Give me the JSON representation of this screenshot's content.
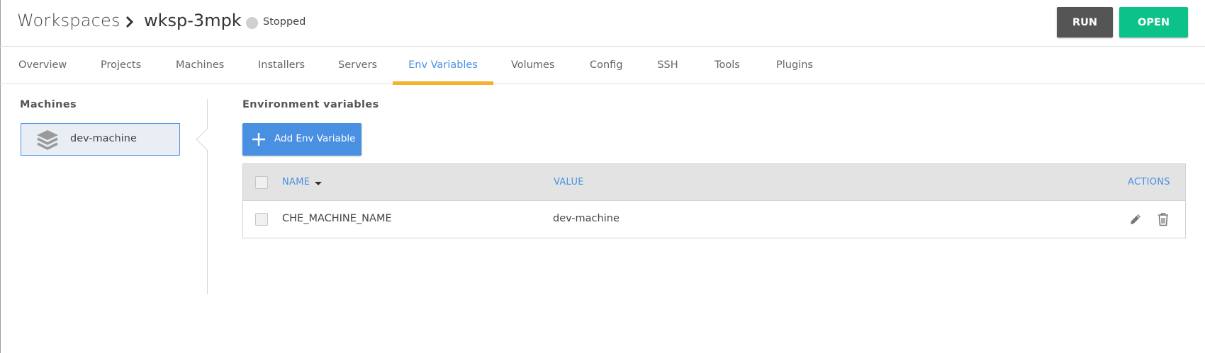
{
  "header": {
    "breadcrumb_root": "Workspaces",
    "workspace_name": "wksp-3mpk",
    "status": "Stopped",
    "run_label": "RUN",
    "open_label": "OPEN"
  },
  "tabs": [
    {
      "label": "Overview"
    },
    {
      "label": "Projects"
    },
    {
      "label": "Machines"
    },
    {
      "label": "Installers"
    },
    {
      "label": "Servers"
    },
    {
      "label": "Env Variables",
      "active": true
    },
    {
      "label": "Volumes"
    },
    {
      "label": "Config"
    },
    {
      "label": "SSH"
    },
    {
      "label": "Tools"
    },
    {
      "label": "Plugins"
    }
  ],
  "machines": {
    "title": "Machines",
    "items": [
      {
        "label": "dev-machine",
        "icon": "stack-layers-icon",
        "selected": true
      }
    ]
  },
  "env": {
    "title": "Environment variables",
    "add_label": "Add Env Variable",
    "columns": {
      "name": "NAME",
      "value": "VALUE",
      "actions": "ACTIONS"
    },
    "rows": [
      {
        "name": "CHE_MACHINE_NAME",
        "value": "dev-machine",
        "actions": [
          "pencil-icon",
          "trash-icon"
        ]
      }
    ]
  },
  "colors": {
    "accent": "#4a90e2",
    "tab_indicator": "#f5b12e",
    "run_button": "#555555",
    "open_button": "#0bc389",
    "status_stopped": "#d0d0d0"
  }
}
